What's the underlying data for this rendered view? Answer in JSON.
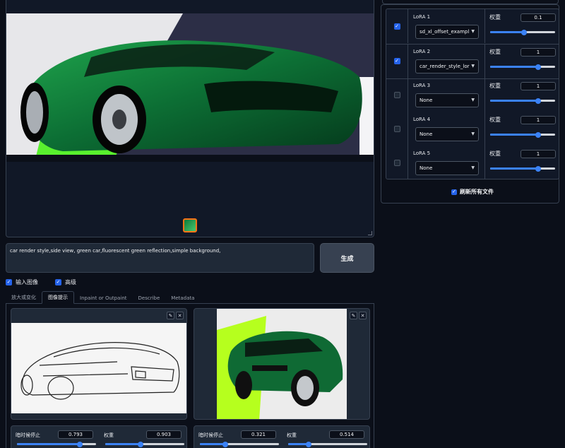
{
  "prompt": {
    "text": "car render style,side view, green car,fluorescent green reflection,simple background,"
  },
  "generate_button": {
    "label": "生成"
  },
  "options": {
    "input_image": {
      "label": "输入图像",
      "checked": true
    },
    "advanced": {
      "label": "高级",
      "checked": true
    }
  },
  "tabs": [
    {
      "label": "放大或变化",
      "active": false
    },
    {
      "label": "图像提示",
      "active": true
    },
    {
      "label": "Inpaint or Outpaint",
      "active": false
    },
    {
      "label": "Describe",
      "active": false
    },
    {
      "label": "Metadata",
      "active": false
    }
  ],
  "image_prompts": [
    {
      "stop_label": "暗时候停止",
      "stop_value": "0.793",
      "weight_label": "权重",
      "weight_value": "0.903",
      "stop_fraction": 0.793,
      "weight_fraction": 0.45
    },
    {
      "stop_label": "暗时候停止",
      "stop_value": "0.321",
      "weight_label": "权重",
      "weight_value": "0.514",
      "stop_fraction": 0.321,
      "weight_fraction": 0.26
    }
  ],
  "loras": [
    {
      "label": "LoRA 1",
      "checked": true,
      "model": "sd_xl_offset_exampl",
      "weight_label": "权重",
      "weight": "0.1",
      "weight_fraction": 0.52
    },
    {
      "label": "LoRA 2",
      "checked": true,
      "model": "car_render_style_lor",
      "weight_label": "权重",
      "weight": "1",
      "weight_fraction": 0.74
    },
    {
      "label": "LoRA 3",
      "checked": false,
      "model": "None",
      "weight_label": "权重",
      "weight": "1",
      "weight_fraction": 0.74
    },
    {
      "label": "LoRA 4",
      "checked": false,
      "model": "None",
      "weight_label": "权重",
      "weight": "1",
      "weight_fraction": 0.74
    },
    {
      "label": "LoRA 5",
      "checked": false,
      "model": "None",
      "weight_label": "权重",
      "weight": "1",
      "weight_fraction": 0.74
    }
  ],
  "refresh": {
    "label": "刷新所有文件",
    "checked": true
  },
  "colors": {
    "accent": "#3b82f6",
    "background": "#0b0f19",
    "panel": "#1f2937",
    "border": "#374151",
    "thumb_border": "#f97316"
  },
  "icons": {
    "edit": "pencil-icon",
    "close": "close-icon",
    "dropdown": "chevron-down-icon",
    "check": "check-icon"
  }
}
